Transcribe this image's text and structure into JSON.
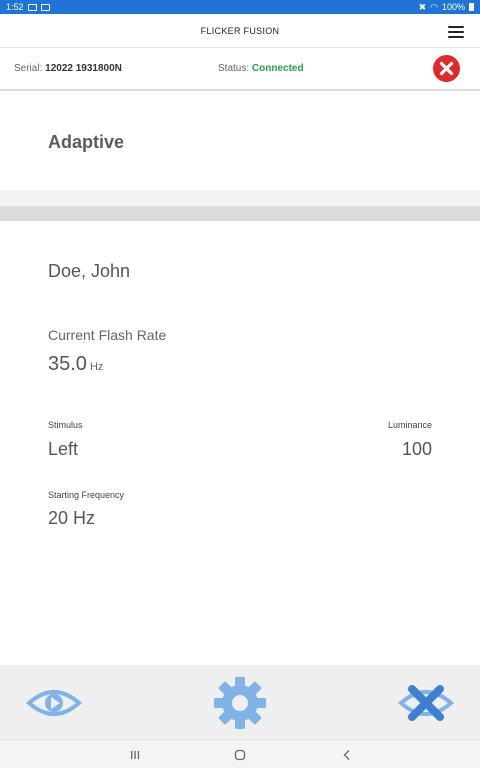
{
  "statusbar": {
    "time": "1:52",
    "battery": "100%"
  },
  "header": {
    "title": "FLICKER FUSION"
  },
  "device": {
    "serial_label": "Serial:",
    "serial_value": "12022 1931800N",
    "status_label": "Status:",
    "status_value": "Connected"
  },
  "mode": {
    "label": "Adaptive"
  },
  "patient": {
    "name": "Doe, John"
  },
  "flash_rate": {
    "label": "Current Flash Rate",
    "value": "35.0",
    "unit": "Hz"
  },
  "stimulus": {
    "label": "Stimulus",
    "value": "Left"
  },
  "luminance": {
    "label": "Luminance",
    "value": "100"
  },
  "starting_frequency": {
    "label": "Starting Frequency",
    "value": "20 Hz"
  },
  "colors": {
    "accent": "#1f74d6",
    "connected": "#2a9d4a",
    "close": "#e02a2a",
    "toolbar_icon": "#7fb3e8"
  },
  "toolbar": {
    "icons": [
      "eye-icon",
      "gear-icon",
      "eye-cancel-icon"
    ]
  },
  "navigation": {
    "icons": [
      "recent-apps-icon",
      "home-icon",
      "back-icon"
    ]
  }
}
